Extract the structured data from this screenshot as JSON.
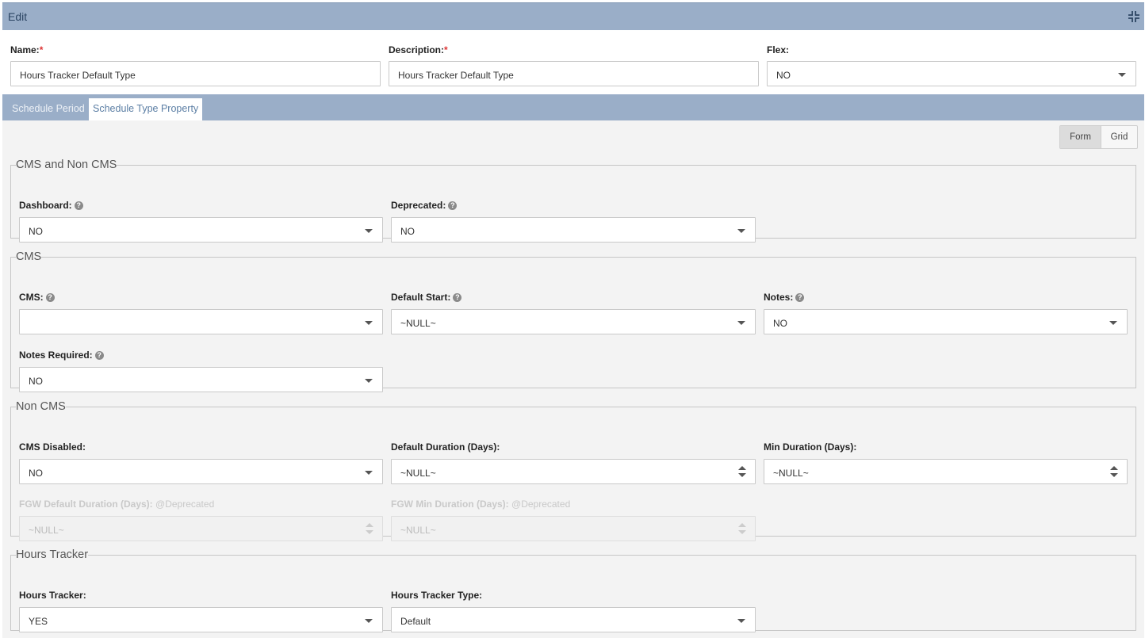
{
  "window": {
    "title": "Edit",
    "collapse_icon": "collapse-icon"
  },
  "header": {
    "name": {
      "label": "Name:",
      "required": "*",
      "value": "Hours Tracker Default Type"
    },
    "description": {
      "label": "Description:",
      "required": "*",
      "value": "Hours Tracker Default Type"
    },
    "flex": {
      "label": "Flex:",
      "value": "NO"
    }
  },
  "tabs": [
    {
      "label": "Schedule Period",
      "active": false
    },
    {
      "label": "Schedule Type Property",
      "active": true
    }
  ],
  "view_toggle": {
    "form": "Form",
    "grid": "Grid",
    "selected": "Form"
  },
  "sections": {
    "cms_and_non_cms": {
      "legend": "CMS and Non CMS",
      "dashboard": {
        "label": "Dashboard:",
        "value": "NO"
      },
      "deprecated": {
        "label": "Deprecated:",
        "value": "NO"
      }
    },
    "cms": {
      "legend": "CMS",
      "cms": {
        "label": "CMS:",
        "value": ""
      },
      "default_start": {
        "label": "Default Start:",
        "value": "~NULL~"
      },
      "notes": {
        "label": "Notes:",
        "value": "NO"
      },
      "notes_required": {
        "label": "Notes Required:",
        "value": "NO"
      }
    },
    "non_cms": {
      "legend": "Non CMS",
      "cms_disabled": {
        "label": "CMS Disabled:",
        "value": "NO"
      },
      "default_duration": {
        "label": "Default Duration (Days):",
        "value": "~NULL~"
      },
      "min_duration": {
        "label": "Min Duration (Days):",
        "value": "~NULL~"
      },
      "fgw_default_duration": {
        "label": "FGW Default Duration (Days):",
        "tag": "@Deprecated",
        "value": "~NULL~"
      },
      "fgw_min_duration": {
        "label": "FGW Min Duration (Days):",
        "tag": "@Deprecated",
        "value": "~NULL~"
      }
    },
    "hours_tracker": {
      "legend": "Hours Tracker",
      "hours_tracker": {
        "label": "Hours Tracker:",
        "value": "YES"
      },
      "hours_tracker_type": {
        "label": "Hours Tracker Type:",
        "value": "Default"
      }
    }
  },
  "help_icon": "help-icon"
}
